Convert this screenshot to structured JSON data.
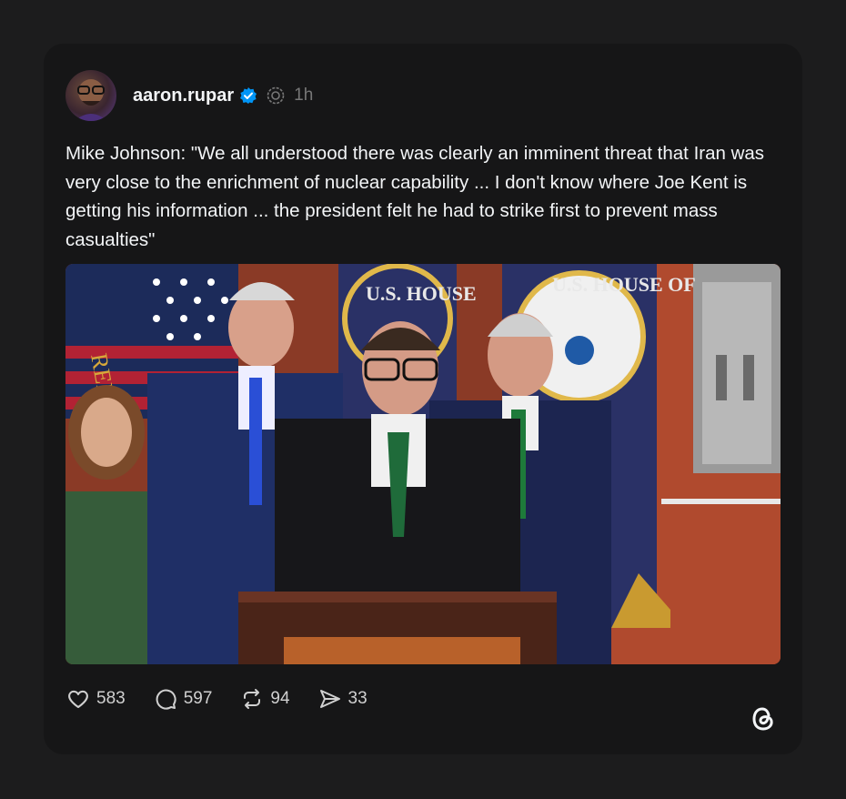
{
  "post": {
    "username": "aaron.rupar",
    "time": "1h",
    "text": "Mike Johnson: \"We all understood there was clearly an imminent threat that Iran was very close to the enrichment of nuclear capability ... I don't know where Joe Kent is getting his information ... the president felt he had to strike first to prevent mass casualties\"",
    "media_description": "photo",
    "media_sign_text_left": "U.S. HOUSE",
    "media_sign_text_right": "U.S. HOUSE OF",
    "media_flag_text": "REPRE"
  },
  "actions": {
    "like": {
      "icon": "heart-icon",
      "count": "583"
    },
    "reply": {
      "icon": "comment-icon",
      "count": "597"
    },
    "repost": {
      "icon": "repost-icon",
      "count": "94"
    },
    "share": {
      "icon": "send-icon",
      "count": "33"
    }
  },
  "colors": {
    "background": "#1c1c1d",
    "card": "#161617",
    "verified": "#0095f6",
    "muted": "#777777"
  }
}
